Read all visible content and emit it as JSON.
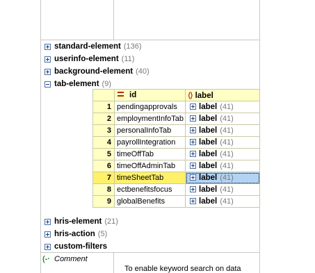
{
  "tree": {
    "nodes_before": [
      {
        "label": "standard-element",
        "count": "(136)",
        "expanded": false
      },
      {
        "label": "userinfo-element",
        "count": "(11)",
        "expanded": false
      },
      {
        "label": "background-element",
        "count": "(40)",
        "expanded": false
      },
      {
        "label": "tab-element",
        "count": "(9)",
        "expanded": true
      }
    ],
    "nodes_after": [
      {
        "label": "hris-element",
        "count": "(21)",
        "expanded": false
      },
      {
        "label": "hris-action",
        "count": "(5)",
        "expanded": false
      },
      {
        "label": "custom-filters",
        "count": "",
        "expanded": false
      }
    ]
  },
  "grid": {
    "header_id": "id",
    "header_label": "label",
    "selected_row": 7,
    "rows": [
      {
        "num": "1",
        "id": "pendingapprovals",
        "label": "label",
        "count": "(41)"
      },
      {
        "num": "2",
        "id": "employmentInfoTab",
        "label": "label",
        "count": "(41)"
      },
      {
        "num": "3",
        "id": "personalInfoTab",
        "label": "label",
        "count": "(41)"
      },
      {
        "num": "4",
        "id": "payrollIntegration",
        "label": "label",
        "count": "(41)"
      },
      {
        "num": "5",
        "id": "timeOffTab",
        "label": "label",
        "count": "(41)"
      },
      {
        "num": "6",
        "id": "timeOffAdminTab",
        "label": "label",
        "count": "(41)"
      },
      {
        "num": "7",
        "id": "timeSheetTab",
        "label": "label",
        "count": "(41)"
      },
      {
        "num": "8",
        "id": "ectbenefitsfocus",
        "label": "label",
        "count": "(41)"
      },
      {
        "num": "9",
        "id": "globalBenefits",
        "label": "label",
        "count": "(41)"
      }
    ]
  },
  "comment": {
    "label": "Comment",
    "text": "To enable keyword search on data"
  },
  "colors": {
    "header_bg": "#ffffc4",
    "selected_id_bg": "#fff06a",
    "selected_label_bg": "#b2d3f3"
  }
}
